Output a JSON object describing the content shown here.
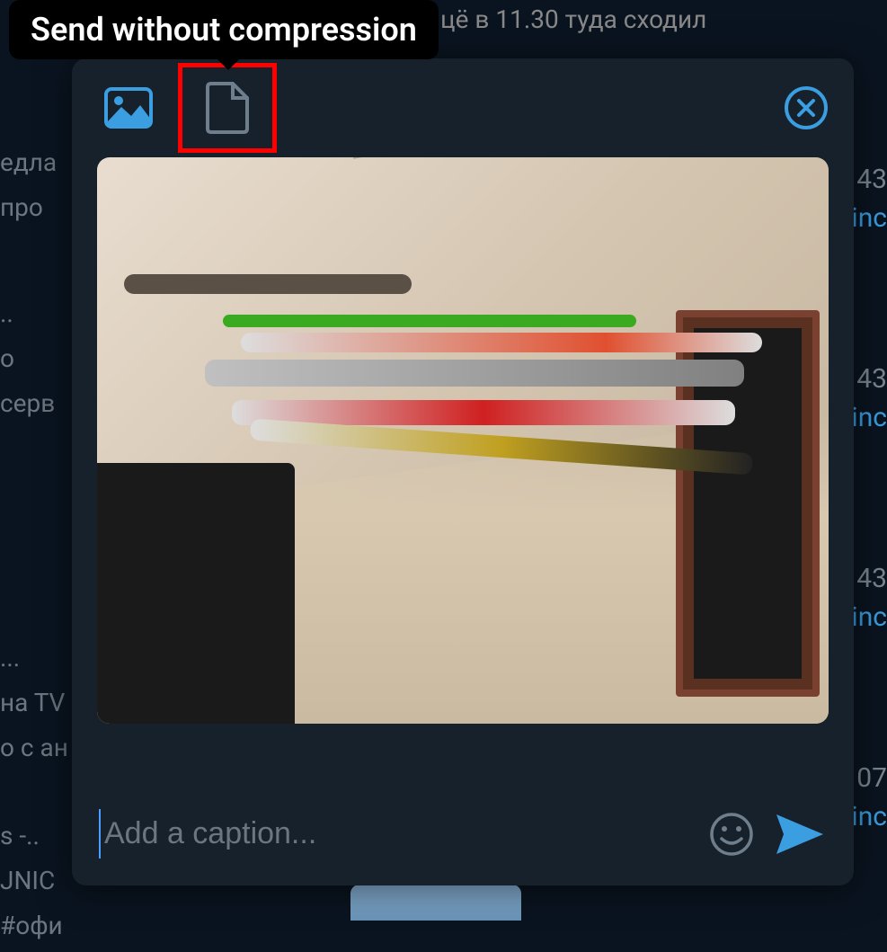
{
  "tooltip": {
    "text": "Send without compression"
  },
  "background_chat": {
    "top_message": "цё в 11.30 туда сходил",
    "left_fragments": [
      "едла",
      "про",
      "..",
      "о",
      "серв",
      "...",
      "на ТV",
      "о с ан",
      "s -..",
      "JNIC",
      "#офи"
    ],
    "right_fragments": [
      {
        "time": "43",
        "link": "inc"
      },
      {
        "time": "43",
        "link": "inc"
      },
      {
        "time": "43",
        "link": "inc"
      },
      {
        "time": "07",
        "link": "inc"
      }
    ]
  },
  "modal": {
    "header": {
      "photo_mode_icon": "image-icon",
      "file_mode_icon": "file-icon",
      "close_icon": "close-icon"
    },
    "caption": {
      "placeholder": "Add a caption...",
      "value": ""
    },
    "emoji_icon": "smiley-icon",
    "send_icon": "send-icon"
  },
  "colors": {
    "accent": "#3b9ee0",
    "highlight_border": "#ff0000",
    "modal_bg": "#17212b",
    "page_bg": "#0a1420",
    "icon_muted": "#6f7e8c"
  }
}
